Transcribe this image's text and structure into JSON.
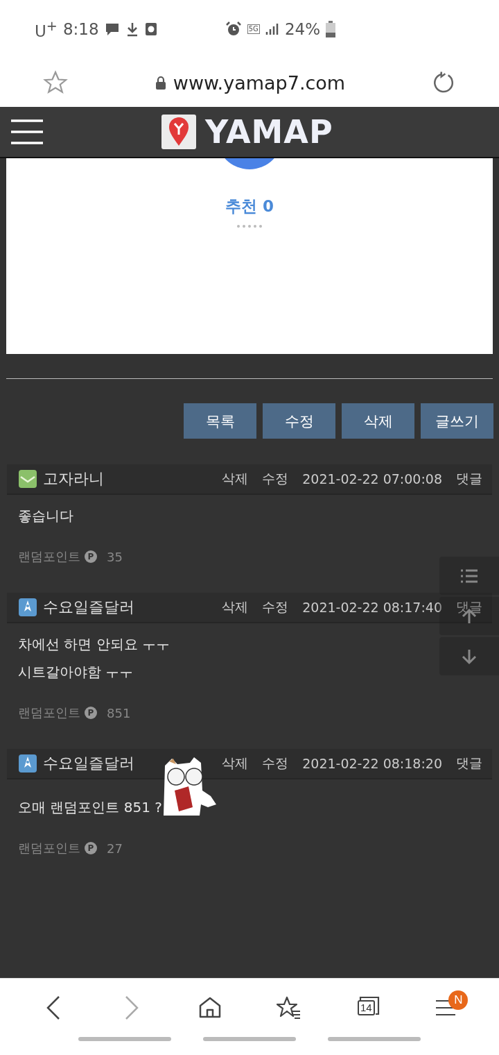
{
  "status_bar": {
    "carrier": "U$^{+}$",
    "time": "8:18",
    "network": "5G",
    "battery": "24%"
  },
  "browser": {
    "url": "www.yamap7.com"
  },
  "site_header": {
    "logo": "YAMAP"
  },
  "post": {
    "recommend": "추천 0"
  },
  "buttons": [
    "목록",
    "수정",
    "삭제",
    "글쓰기"
  ],
  "comments": [
    {
      "author": "고자라니",
      "kind": "envelope",
      "actions": [
        "삭제",
        "수정"
      ],
      "date": "2021-02-22 07:00:08",
      "reply": "댓글",
      "lines": [
        "좋습니다"
      ],
      "sticker": false,
      "points_label": "랜덤포인트",
      "points_icon": "P",
      "points": "35"
    },
    {
      "author": "수요일즐달러",
      "kind": "rocket",
      "actions": [
        "삭제",
        "수정"
      ],
      "date": "2021-02-22 08:17:40",
      "reply": "댓글",
      "lines": [
        "차에선 하면 안되요 ㅜㅜ",
        "시트갈아야함 ㅜㅜ"
      ],
      "sticker": false,
      "points_label": "랜덤포인트",
      "points_icon": "P",
      "points": "851"
    },
    {
      "author": "수요일즐달러",
      "kind": "rocket",
      "actions": [
        "삭제",
        "수정"
      ],
      "date": "2021-02-22 08:18:20",
      "reply": "댓글",
      "lines": [
        "오매 랜덤포인트 851 ?"
      ],
      "sticker": true,
      "points_label": "랜덤포인트",
      "points_icon": "P",
      "points": "27"
    }
  ],
  "bottom_nav": {
    "tab_count": "14",
    "menu_badge": "N"
  }
}
